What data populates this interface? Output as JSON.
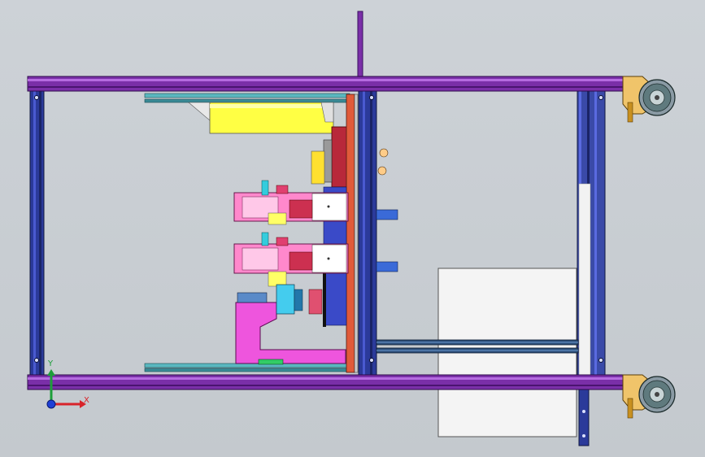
{
  "viewport": {
    "background": "#c9ced3",
    "frame_color": "#7a2fa8",
    "frame_highlight": "#b56be0",
    "post_color": "#2b3a9a",
    "caster_color": "#f0c46a"
  },
  "triad": {
    "x_label": "X",
    "y_label": "Y",
    "x_color": "#d8232a",
    "y_color": "#1d9e3a",
    "z_color": "#1e3fd6"
  }
}
